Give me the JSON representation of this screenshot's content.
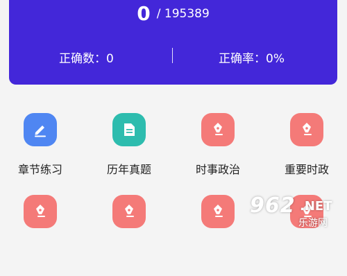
{
  "stats": {
    "done": "0",
    "total": "/ 195389",
    "correct_count": "正确数：0",
    "correct_rate": "正确率：0%"
  },
  "colors": {
    "header_bg": "#4327d9",
    "blue_tile": "#4f86f2",
    "teal_tile": "#2dbcae",
    "red_tile": "#f47a78"
  },
  "menu": [
    {
      "label": "章节练习",
      "icon": "pencil-lines-icon",
      "color": "#4f86f2"
    },
    {
      "label": "历年真题",
      "icon": "document-icon",
      "color": "#2dbcae"
    },
    {
      "label": "时事政治",
      "icon": "pen-nib-icon",
      "color": "#f47a78"
    },
    {
      "label": "重要时政",
      "icon": "pen-nib-icon",
      "color": "#f47a78"
    },
    {
      "label": "",
      "icon": "pen-nib-icon",
      "color": "#f47a78"
    },
    {
      "label": "",
      "icon": "pen-nib-icon",
      "color": "#f47a78"
    },
    {
      "label": "",
      "icon": "pen-nib-icon",
      "color": "#f47a78"
    },
    {
      "label": "",
      "icon": "pen-nib-icon",
      "color": "#f47a78"
    }
  ],
  "watermark": {
    "number": "962",
    "suffix": ".NET",
    "brand": "乐游网"
  }
}
